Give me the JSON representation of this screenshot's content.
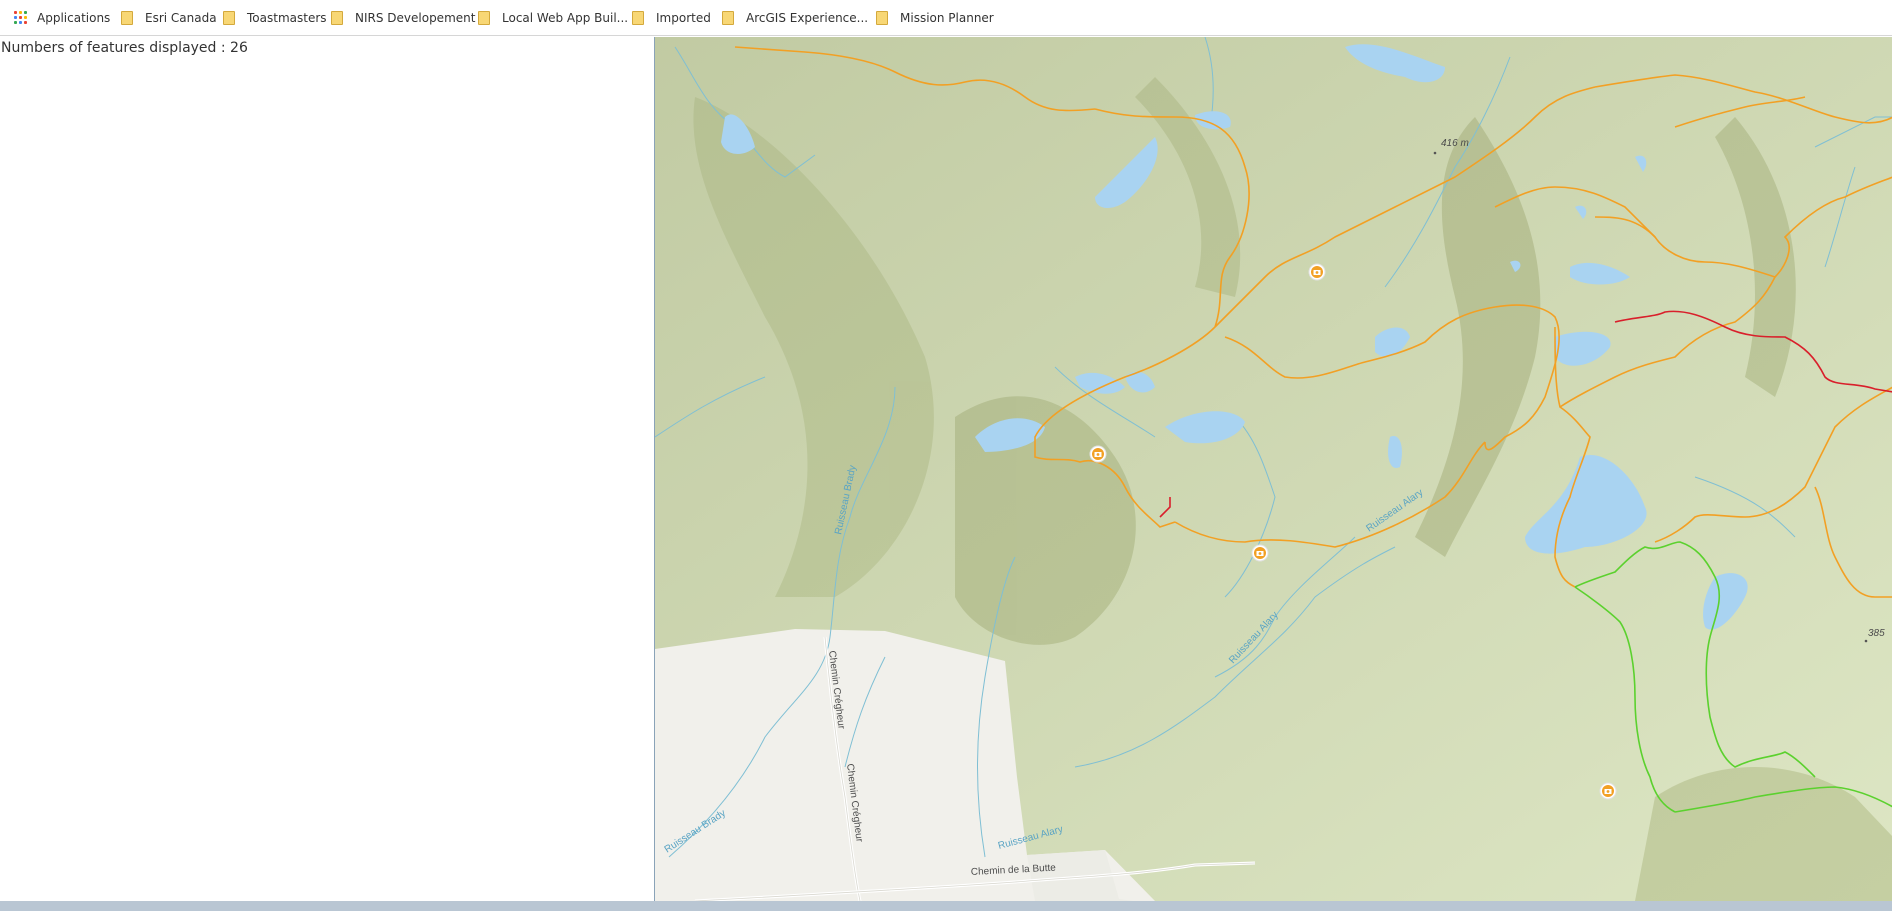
{
  "bookmarks": [
    {
      "label": "Applications",
      "icon": "apps-grid-icon"
    },
    {
      "label": "Esri Canada",
      "icon": "folder-icon"
    },
    {
      "label": "Toastmasters",
      "icon": "folder-icon"
    },
    {
      "label": "NIRS Developement",
      "icon": "folder-icon"
    },
    {
      "label": "Local Web App Buil...",
      "icon": "folder-icon"
    },
    {
      "label": "Imported",
      "icon": "folder-icon"
    },
    {
      "label": "ArcGIS Experience...",
      "icon": "folder-icon"
    },
    {
      "label": "Mission Planner",
      "icon": "folder-icon"
    }
  ],
  "panel": {
    "feature_count_text": "Numbers of features displayed : 26"
  },
  "map": {
    "labels": {
      "elev_416": "416 m",
      "elev_385": "385",
      "ruisseau_brady_north": "Ruisseau Brady",
      "ruisseau_brady_south": "Ruisseau Brady",
      "ruisseau_alary_1": "Ruisseau Alary",
      "ruisseau_alary_2": "Ruisseau Alary",
      "ruisseau_alary_3": "Ruisseau Alary",
      "chemin_cregheur_1": "Chemin Crégheur",
      "chemin_cregheur_2": "Chemin Crégheur",
      "chemin_de_la_butte": "Chemin de la Butte"
    },
    "colors": {
      "terrain": "#dde6c4",
      "water": "#a9d3f1",
      "stream": "#7fbfd4",
      "cleared_land": "#f1f0eb",
      "trail_orange": "#f2a024",
      "trail_red": "#d91f2b",
      "trail_green": "#5bd12e",
      "marker": "#f2a024"
    },
    "marker_icon": "camera-icon"
  }
}
